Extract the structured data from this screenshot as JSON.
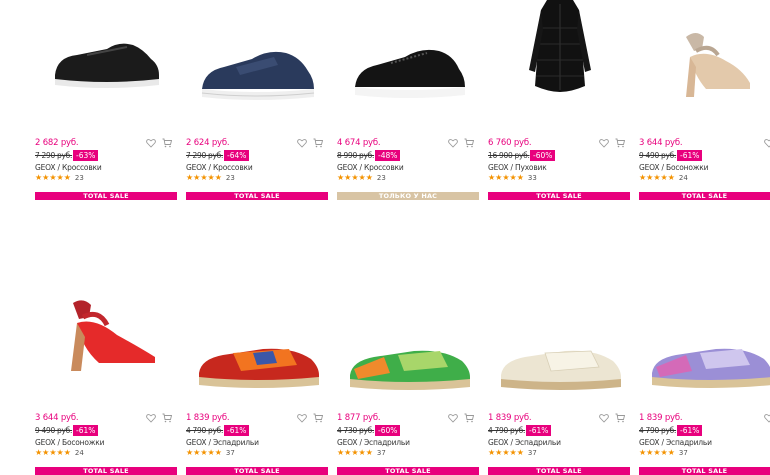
{
  "products": [
    {
      "price": "2 682 руб.",
      "old_price": "7 290 руб.",
      "discount": "-63%",
      "brand": "GEOX",
      "category": "Кроссовки",
      "rating_count": "23",
      "banner": "TOTAL SALE",
      "banner_style": "pink",
      "image": "sneaker-black"
    },
    {
      "price": "2 624 руб.",
      "old_price": "7 290 руб.",
      "discount": "-64%",
      "brand": "GEOX",
      "category": "Кроссовки",
      "rating_count": "23",
      "banner": "TOTAL SALE",
      "banner_style": "pink",
      "image": "sneaker-navy"
    },
    {
      "price": "4 674 руб.",
      "old_price": "8 990 руб.",
      "discount": "-48%",
      "brand": "GEOX",
      "category": "Кроссовки",
      "rating_count": "23",
      "banner": "ТОЛЬКО У НАС",
      "banner_style": "beige",
      "image": "sneaker-black-laceless"
    },
    {
      "price": "6 760 руб.",
      "old_price": "16 900 руб.",
      "discount": "-60%",
      "brand": "GEOX",
      "category": "Пуховик",
      "rating_count": "33",
      "banner": "TOTAL SALE",
      "banner_style": "pink",
      "image": "coat-black"
    },
    {
      "price": "3 644 руб.",
      "old_price": "9 490 руб.",
      "discount": "-61%",
      "brand": "GEOX",
      "category": "Босоножки",
      "rating_count": "24",
      "banner": "TOTAL SALE",
      "banner_style": "pink",
      "image": "sandal-beige"
    },
    {
      "price": "3 644 руб.",
      "old_price": "9 490 руб.",
      "discount": "-61%",
      "brand": "GEOX",
      "category": "Босоножки",
      "rating_count": "24",
      "banner": "TOTAL SALE",
      "banner_style": "pink",
      "image": "sandal-red"
    },
    {
      "price": "1 839 руб.",
      "old_price": "4 790 руб.",
      "discount": "-61%",
      "brand": "GEOX",
      "category": "Эспадрильи",
      "rating_count": "37",
      "banner": "TOTAL SALE",
      "banner_style": "pink",
      "image": "espadrille-red"
    },
    {
      "price": "1 877 руб.",
      "old_price": "4 730 руб.",
      "discount": "-60%",
      "brand": "GEOX",
      "category": "Эспадрильи",
      "rating_count": "37",
      "banner": "TOTAL SALE",
      "banner_style": "pink",
      "image": "espadrille-green"
    },
    {
      "price": "1 839 руб.",
      "old_price": "4 790 руб.",
      "discount": "-61%",
      "brand": "GEOX",
      "category": "Эспадрильи",
      "rating_count": "37",
      "banner": "TOTAL SALE",
      "banner_style": "pink",
      "image": "espadrille-cream"
    },
    {
      "price": "1 839 руб.",
      "old_price": "4 790 руб.",
      "discount": "-61%",
      "brand": "GEOX",
      "category": "Эспадрильи",
      "rating_count": "37",
      "banner": "TOTAL SALE",
      "banner_style": "pink",
      "image": "espadrille-purple"
    }
  ],
  "rating_stars": "★★★★★",
  "separator": "/",
  "icons": {
    "wishlist": "heart-icon",
    "cart": "cart-icon"
  },
  "colors": {
    "accent": "#e8007d",
    "star": "#f39200",
    "exclusive": "#d8c4a4"
  }
}
